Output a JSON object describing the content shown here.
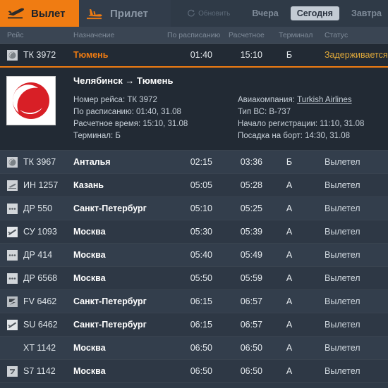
{
  "header": {
    "tabs": [
      {
        "label": "Вылет",
        "icon": "plane-takeoff-icon",
        "active": true
      },
      {
        "label": "Прилет",
        "icon": "plane-landing-icon",
        "active": false
      }
    ],
    "refresh": {
      "label": "Обновить",
      "icon": "refresh-icon"
    },
    "day_tabs": [
      {
        "label": "Вчера",
        "active": false
      },
      {
        "label": "Сегодня",
        "active": true
      },
      {
        "label": "Завтра",
        "active": false
      }
    ]
  },
  "colors": {
    "accent": "#f07c12",
    "background": "#2f3a47",
    "row": "#333e4c",
    "row_alt": "#2e3845",
    "selected_row": "#222a34",
    "status_delayed": "#e0a93a"
  },
  "table": {
    "columns": {
      "flight": "Рейс",
      "destination": "Назначение",
      "scheduled": "По расписанию",
      "estimated": "Расчетное",
      "terminal": "Терминал",
      "status": "Статус"
    },
    "rows": [
      {
        "icon": "turkish-airlines-icon",
        "flight": "ТК 3972",
        "destination": "Тюмень",
        "scheduled": "01:40",
        "estimated": "15:10",
        "terminal": "Б",
        "status": "Задерживается",
        "selected": true
      },
      {
        "icon": "turkish-airlines-icon",
        "flight": "ТК 3967",
        "destination": "Анталья",
        "scheduled": "02:15",
        "estimated": "03:36",
        "terminal": "Б",
        "status": "Вылетел",
        "selected": false
      },
      {
        "icon": "nordwind-icon",
        "flight": "ИН 1257",
        "destination": "Казань",
        "scheduled": "05:05",
        "estimated": "05:28",
        "terminal": "А",
        "status": "Вылетел",
        "selected": false
      },
      {
        "icon": "dots-icon",
        "flight": "ДР 550",
        "destination": "Санкт-Петербург",
        "scheduled": "05:10",
        "estimated": "05:25",
        "terminal": "А",
        "status": "Вылетел",
        "selected": false
      },
      {
        "icon": "aeroflot-icon",
        "flight": "СУ 1093",
        "destination": "Москва",
        "scheduled": "05:30",
        "estimated": "05:39",
        "terminal": "А",
        "status": "Вылетел",
        "selected": false
      },
      {
        "icon": "dots-icon",
        "flight": "ДР 414",
        "destination": "Москва",
        "scheduled": "05:40",
        "estimated": "05:49",
        "terminal": "А",
        "status": "Вылетел",
        "selected": false
      },
      {
        "icon": "dots-icon",
        "flight": "ДР 6568",
        "destination": "Москва",
        "scheduled": "05:50",
        "estimated": "05:59",
        "terminal": "А",
        "status": "Вылетел",
        "selected": false
      },
      {
        "icon": "rossiya-icon",
        "flight": "FV 6462",
        "destination": "Санкт-Петербург",
        "scheduled": "06:15",
        "estimated": "06:57",
        "terminal": "А",
        "status": "Вылетел",
        "selected": false
      },
      {
        "icon": "aeroflot-icon",
        "flight": "SU 6462",
        "destination": "Санкт-Петербург",
        "scheduled": "06:15",
        "estimated": "06:57",
        "terminal": "А",
        "status": "Вылетел",
        "selected": false
      },
      {
        "icon": "none",
        "flight": "XT 1142",
        "destination": "Москва",
        "scheduled": "06:50",
        "estimated": "06:50",
        "terminal": "А",
        "status": "Вылетел",
        "selected": false
      },
      {
        "icon": "s7-icon",
        "flight": "S7 1142",
        "destination": "Москва",
        "scheduled": "06:50",
        "estimated": "06:50",
        "terminal": "А",
        "status": "Вылетел",
        "selected": false
      }
    ]
  },
  "detail": {
    "logo": "turkish-airlines-logo",
    "title": "Челябинск → Тюмень",
    "left": {
      "flight_number": "Номер рейса: ТК 3972",
      "scheduled": "По расписанию: 01:40, 31.08",
      "estimated": "Расчетное время: 15:10, 31.08",
      "terminal": "Терминал: Б"
    },
    "right": {
      "airline_label": "Авиакомпания:",
      "airline_name": "Turkish Airlines",
      "aircraft": "Тип ВС: B-737",
      "checkin": "Начало регистрации: 11:10, 31.08",
      "boarding": "Посадка на борт: 14:30, 31.08"
    }
  }
}
